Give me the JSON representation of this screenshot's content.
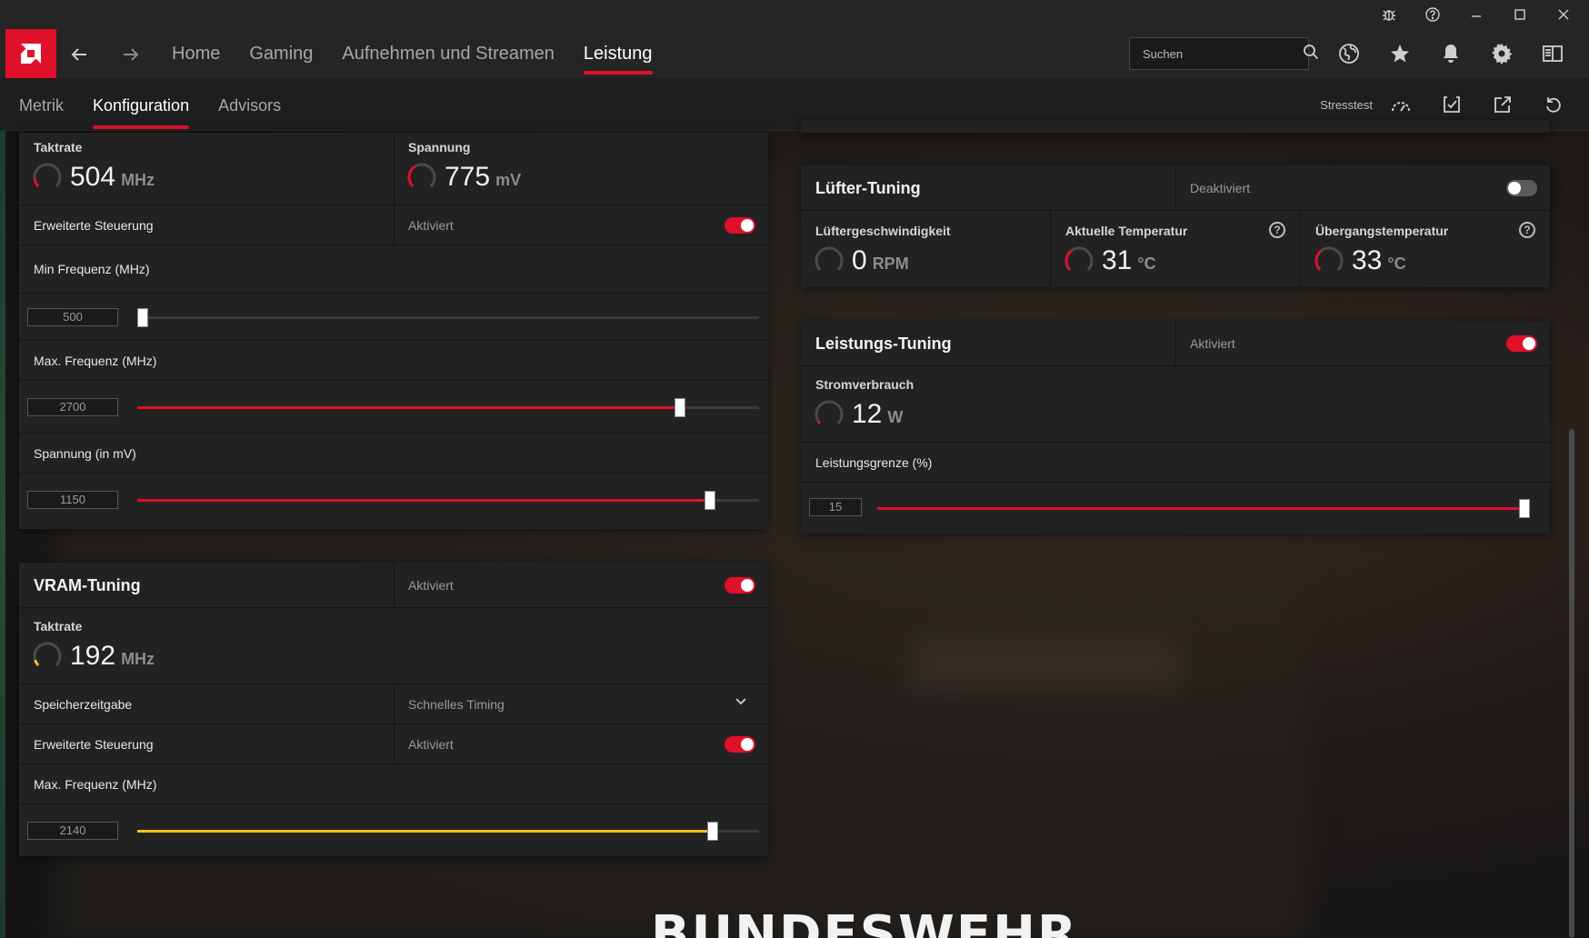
{
  "titlebar": {
    "icons": [
      "bug-icon",
      "help-icon",
      "minimize-icon",
      "maximize-icon",
      "close-icon"
    ]
  },
  "nav": {
    "tabs": [
      "Home",
      "Gaming",
      "Aufnehmen und Streamen",
      "Leistung"
    ],
    "active_tab": "Leistung",
    "search_placeholder": "Suchen"
  },
  "subnav": {
    "tabs": [
      "Metrik",
      "Konfiguration",
      "Advisors"
    ],
    "active_tab": "Konfiguration",
    "stresstest_label": "Stresstest"
  },
  "gpu": {
    "clock": {
      "label": "Taktrate",
      "value": "504",
      "unit": "MHz",
      "gauge_level": 0.15
    },
    "voltage": {
      "label": "Spannung",
      "value": "775",
      "unit": "mV",
      "gauge_level": 0.4
    },
    "advanced": {
      "label": "Erweiterte Steuerung",
      "status": "Aktiviert",
      "enabled": true
    },
    "min_freq": {
      "label": "Min Frequenz (MHz)",
      "value": "500",
      "level": 0.0
    },
    "max_freq": {
      "label": "Max. Frequenz (MHz)",
      "value": "2700",
      "level": 0.873
    },
    "voltage_slider": {
      "label": "Spannung (in mV)",
      "value": "1150",
      "level": 0.921
    }
  },
  "vram": {
    "title": "VRAM-Tuning",
    "status": "Aktiviert",
    "enabled": true,
    "clock": {
      "label": "Taktrate",
      "value": "192",
      "unit": "MHz",
      "gauge_level": 0.1
    },
    "timing": {
      "label": "Speicherzeitgabe",
      "value": "Schnelles Timing"
    },
    "advanced": {
      "label": "Erweiterte Steuerung",
      "status": "Aktiviert",
      "enabled": true
    },
    "max_freq": {
      "label": "Max. Frequenz (MHz)",
      "value": "2140",
      "level": 0.925
    }
  },
  "fan": {
    "title": "Lüfter-Tuning",
    "status": "Deaktiviert",
    "enabled": false,
    "speed": {
      "label": "Lüftergeschwindigkeit",
      "value": "0",
      "unit": "RPM",
      "gauge_level": 0
    },
    "temp": {
      "label": "Aktuelle Temperatur",
      "value": "31",
      "unit": "°C",
      "gauge_level": 0.35
    },
    "junction": {
      "label": "Übergangstemperatur",
      "value": "33",
      "unit": "°C",
      "gauge_level": 0.35
    }
  },
  "power": {
    "title": "Leistungs-Tuning",
    "status": "Aktiviert",
    "enabled": true,
    "consumption": {
      "label": "Stromverbrauch",
      "value": "12",
      "unit": "W",
      "gauge_level": 0.05
    },
    "limit": {
      "label": "Leistungsgrenze (%)",
      "value": "15",
      "level": 1.0
    }
  },
  "background_text": "BUNDESWEHR",
  "colors": {
    "accent": "#e0102a",
    "vram_accent": "#f2c21b",
    "panel": "#222222"
  }
}
